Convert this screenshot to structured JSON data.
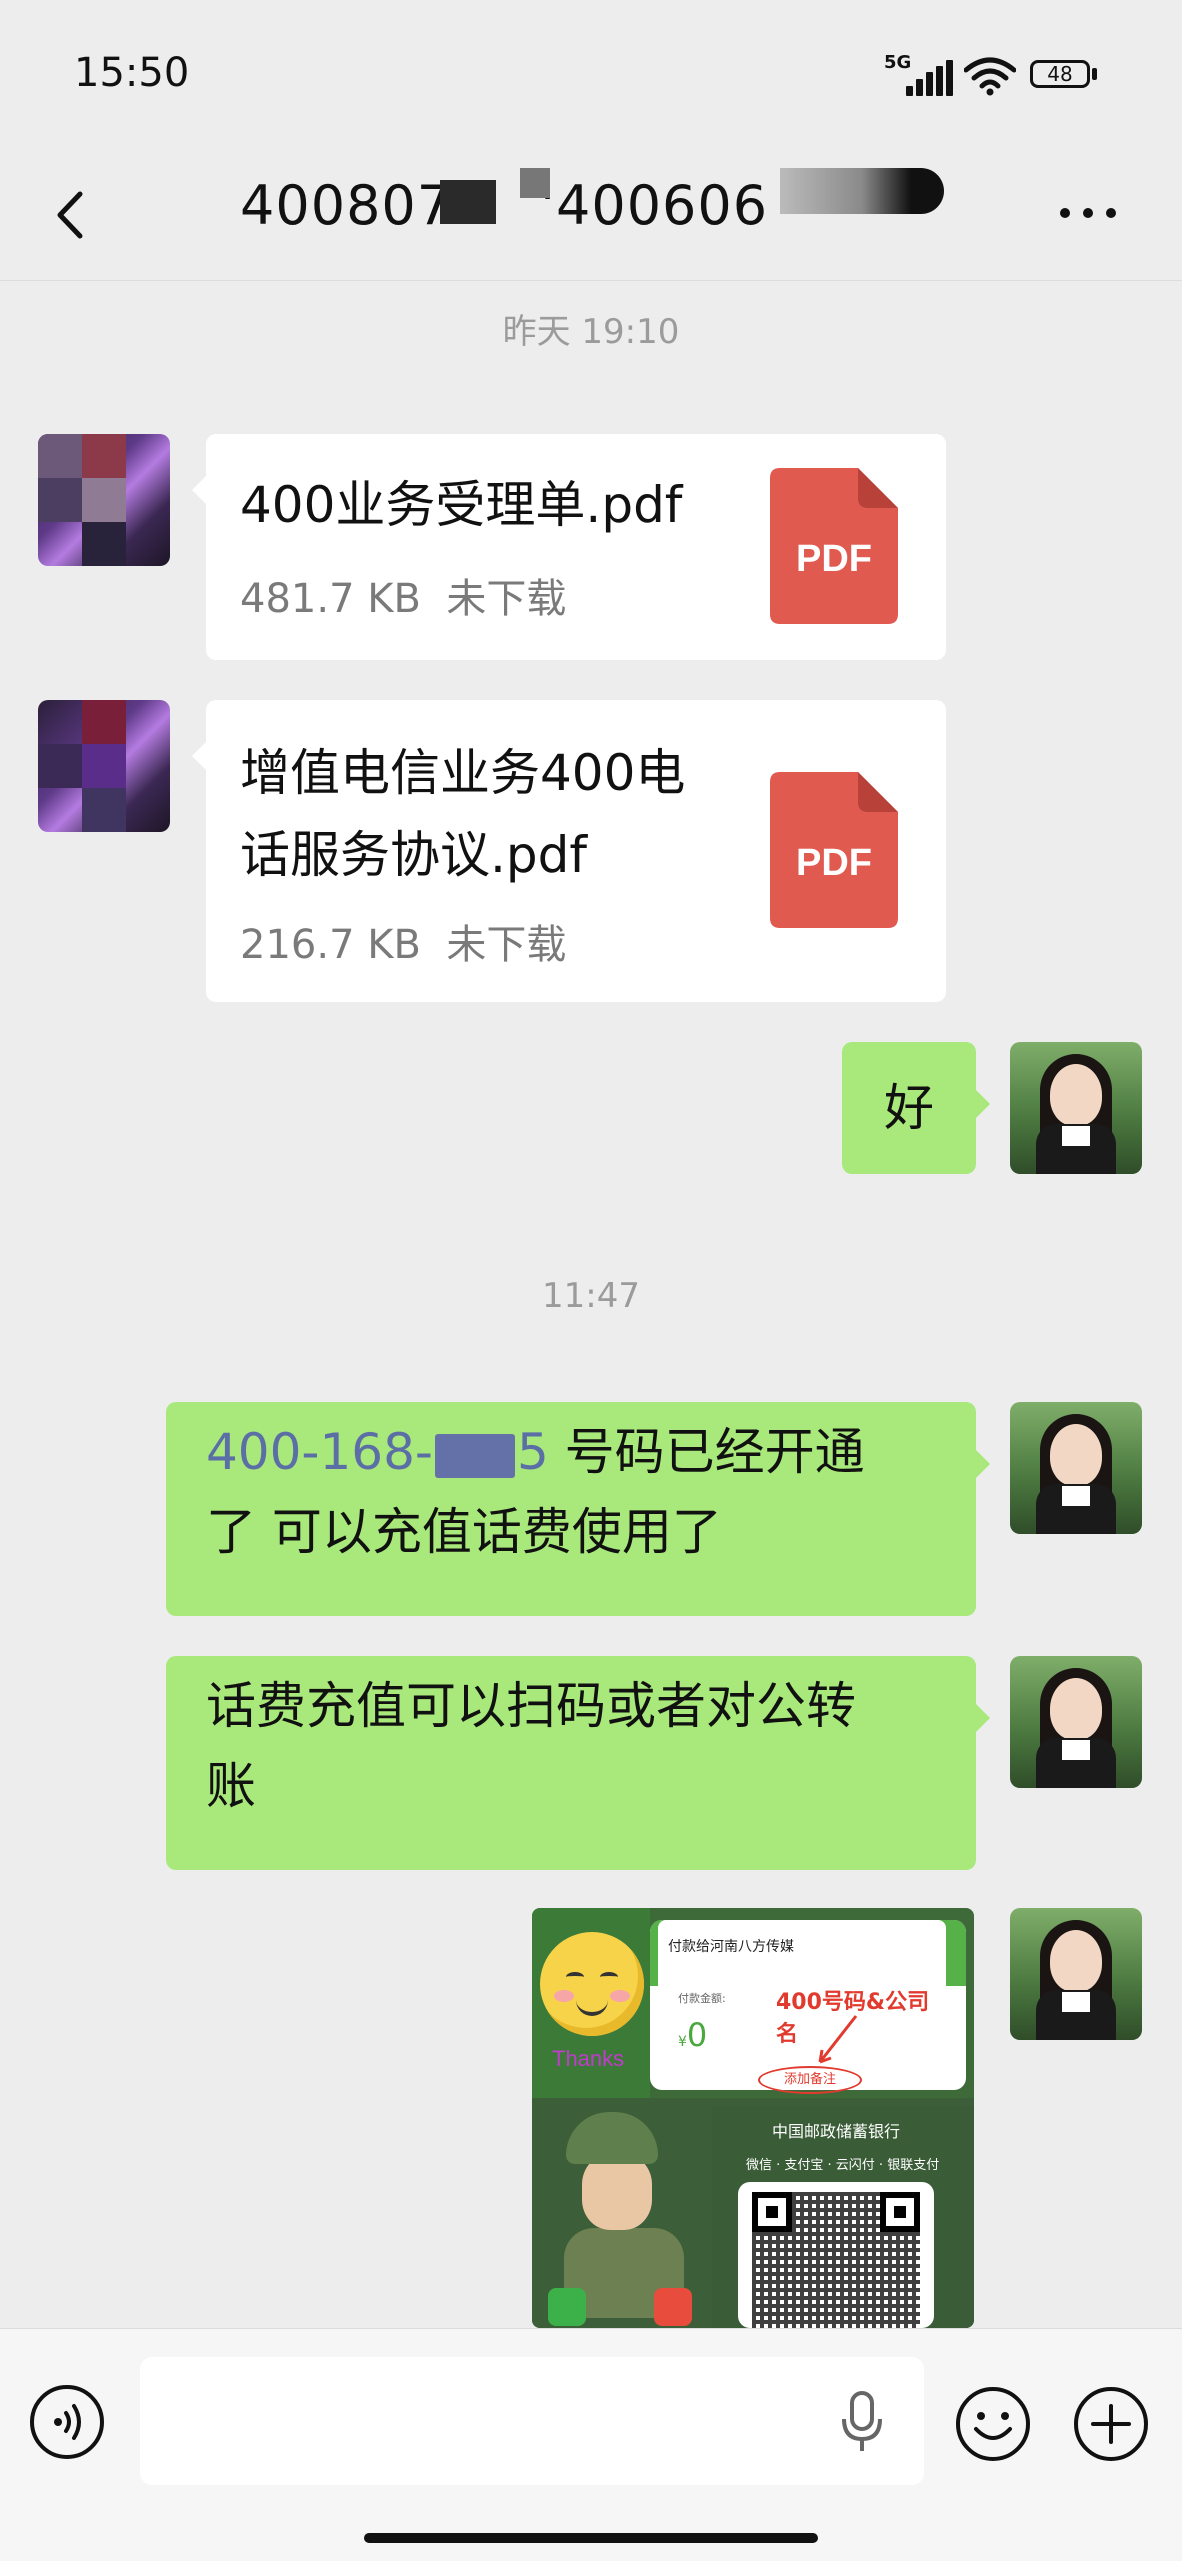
{
  "status_bar": {
    "time": "15:50",
    "network": "5G",
    "battery": "48"
  },
  "header": {
    "title_left": "400807",
    "title_right": "'400606"
  },
  "messages": {
    "timestamp_1": "昨天 19:10",
    "file_1": {
      "name": "400业务受理单.pdf",
      "size": "481.7 KB",
      "status": "未下载",
      "icon_label": "PDF"
    },
    "file_2": {
      "name_line1": "增值电信业务400电",
      "name_line2": "话服务协议.pdf",
      "size": "216.7 KB",
      "status": "未下载",
      "icon_label": "PDF"
    },
    "reply_ok": "好",
    "timestamp_2": "11:47",
    "msg_opened": {
      "phone_prefix": "400-168-",
      "phone_suffix": "5",
      "line1_rest": "号码已经开通",
      "line2": "了 可以充值话费使用了"
    },
    "msg_recharge": {
      "line1": "话费充值可以扫码或者对公转",
      "line2": "账"
    },
    "image": {
      "thanks": "Thanks",
      "pay_title": "付款给河南八方传媒",
      "amount_label": "付款金额:",
      "amount_currency": "¥",
      "amount": "0",
      "note": "400号码&公司名",
      "remark_button": "添加备注",
      "bank_name": "中国邮政储蓄银行",
      "pay_methods": "微信 · 支付宝 · 云闪付 · 银联支付"
    }
  },
  "input": {
    "placeholder": ""
  },
  "colors": {
    "bubble_green": "#a9e97b",
    "pdf_red": "#e05a50",
    "link_blue": "#5b6fa6"
  }
}
